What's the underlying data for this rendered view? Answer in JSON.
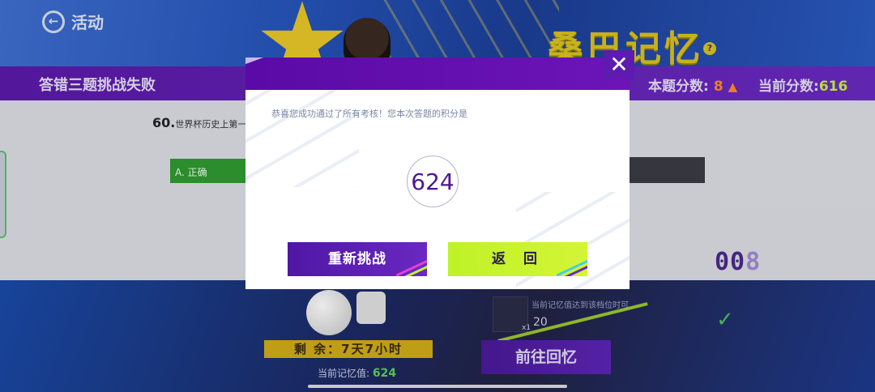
{
  "header": {
    "back_label": "活动",
    "page_title": "桑巴记忆",
    "help_glyph": "?"
  },
  "status_bar": {
    "fail_text": "答错三题挑战失败",
    "question_score_label": "本题分数:",
    "question_score_value": "8",
    "current_score_label": "当前分数:",
    "current_score_value": "616"
  },
  "question": {
    "number": "60.",
    "text": "世界杯历史上第一",
    "option_a": "A. 正确"
  },
  "counter": {
    "digits_main": "00",
    "digit_dim": "8"
  },
  "bottom": {
    "remain_text": "剩  余：7天7小时",
    "memory_label": "当前记忆值:",
    "memory_value": "624",
    "reward_note": "当前记忆值达到该档位时可",
    "reward_value": "20",
    "reward_count": "x1",
    "goto_label": "前往回忆"
  },
  "modal": {
    "message": "恭喜您成功通过了所有考核！您本次答题的积分是",
    "score": "624",
    "retry_label": "重新挑战",
    "back_label": "返 回",
    "close_glyph": "✕"
  },
  "colors": {
    "accent_purple": "#5a0aa6",
    "accent_lime": "#c8f040",
    "score_purple": "#4d1693"
  }
}
